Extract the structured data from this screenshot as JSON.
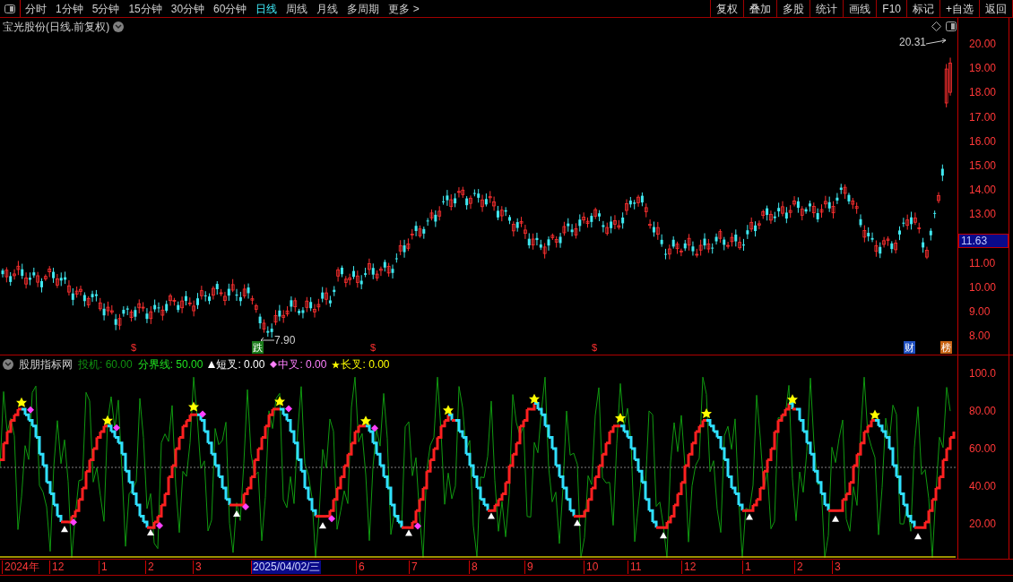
{
  "toolbar": {
    "periods": [
      {
        "label": "分时",
        "selected": false
      },
      {
        "label": "1分钟",
        "selected": false
      },
      {
        "label": "5分钟",
        "selected": false
      },
      {
        "label": "15分钟",
        "selected": false
      },
      {
        "label": "30分钟",
        "selected": false
      },
      {
        "label": "60分钟",
        "selected": false
      },
      {
        "label": "日线",
        "selected": true
      },
      {
        "label": "周线",
        "selected": false
      },
      {
        "label": "月线",
        "selected": false
      },
      {
        "label": "多周期",
        "selected": false
      },
      {
        "label": "更多 >",
        "selected": false
      }
    ],
    "buttons": [
      "复权",
      "叠加",
      "多股",
      "统计",
      "画线",
      "F10",
      "标记",
      "+自选",
      "返回"
    ]
  },
  "main_chart": {
    "title": "宝光股份(日线.前复权)",
    "price_ticks": [
      "20.00",
      "19.00",
      "18.00",
      "17.00",
      "16.00",
      "15.00",
      "14.00",
      "13.00",
      "11.00",
      "10.00",
      "9.00",
      "8.00"
    ],
    "current_price": "11.63",
    "high_label": "20.31",
    "low_label": "7.90",
    "events": [
      {
        "kind": "dollar",
        "text": "$"
      },
      {
        "kind": "badge",
        "text": "跌",
        "color": "#1a7a1a"
      },
      {
        "kind": "dollar",
        "text": "$"
      },
      {
        "kind": "dollar",
        "text": "$"
      },
      {
        "kind": "badge",
        "text": "财",
        "color": "#2050c0"
      },
      {
        "kind": "badge",
        "text": "榜",
        "color": "#c86414"
      }
    ]
  },
  "indicator": {
    "name": "股朋指标网",
    "items": [
      {
        "label": "投机: 60.00",
        "color": "#109010",
        "kind": "none"
      },
      {
        "label": "分界线: 50.00",
        "color": "#20e020",
        "kind": "none"
      },
      {
        "label": "短叉: 0.00",
        "color": "#ffffff",
        "kind": "triangle"
      },
      {
        "label": "中叉: 0.00",
        "color": "#ff80ff",
        "kind": "diamond"
      },
      {
        "label": "长叉: 0.00",
        "color": "#ffff00",
        "kind": "star"
      }
    ],
    "ticks": [
      "100.0",
      "80.00",
      "60.00",
      "40.00",
      "20.00"
    ]
  },
  "date_axis": [
    {
      "label": "2024年",
      "selected": false
    },
    {
      "label": "12",
      "selected": false
    },
    {
      "label": "1",
      "selected": false
    },
    {
      "label": "2",
      "selected": false
    },
    {
      "label": "3",
      "selected": false
    },
    {
      "label": "2025/04/02/三",
      "selected": true
    },
    {
      "label": "6",
      "selected": false
    },
    {
      "label": "7",
      "selected": false
    },
    {
      "label": "8",
      "selected": false
    },
    {
      "label": "9",
      "selected": false
    },
    {
      "label": "10",
      "selected": false
    },
    {
      "label": "11",
      "selected": false
    },
    {
      "label": "12",
      "selected": false
    },
    {
      "label": "1",
      "selected": false
    },
    {
      "label": "2",
      "selected": false
    },
    {
      "label": "3",
      "selected": false
    }
  ]
}
